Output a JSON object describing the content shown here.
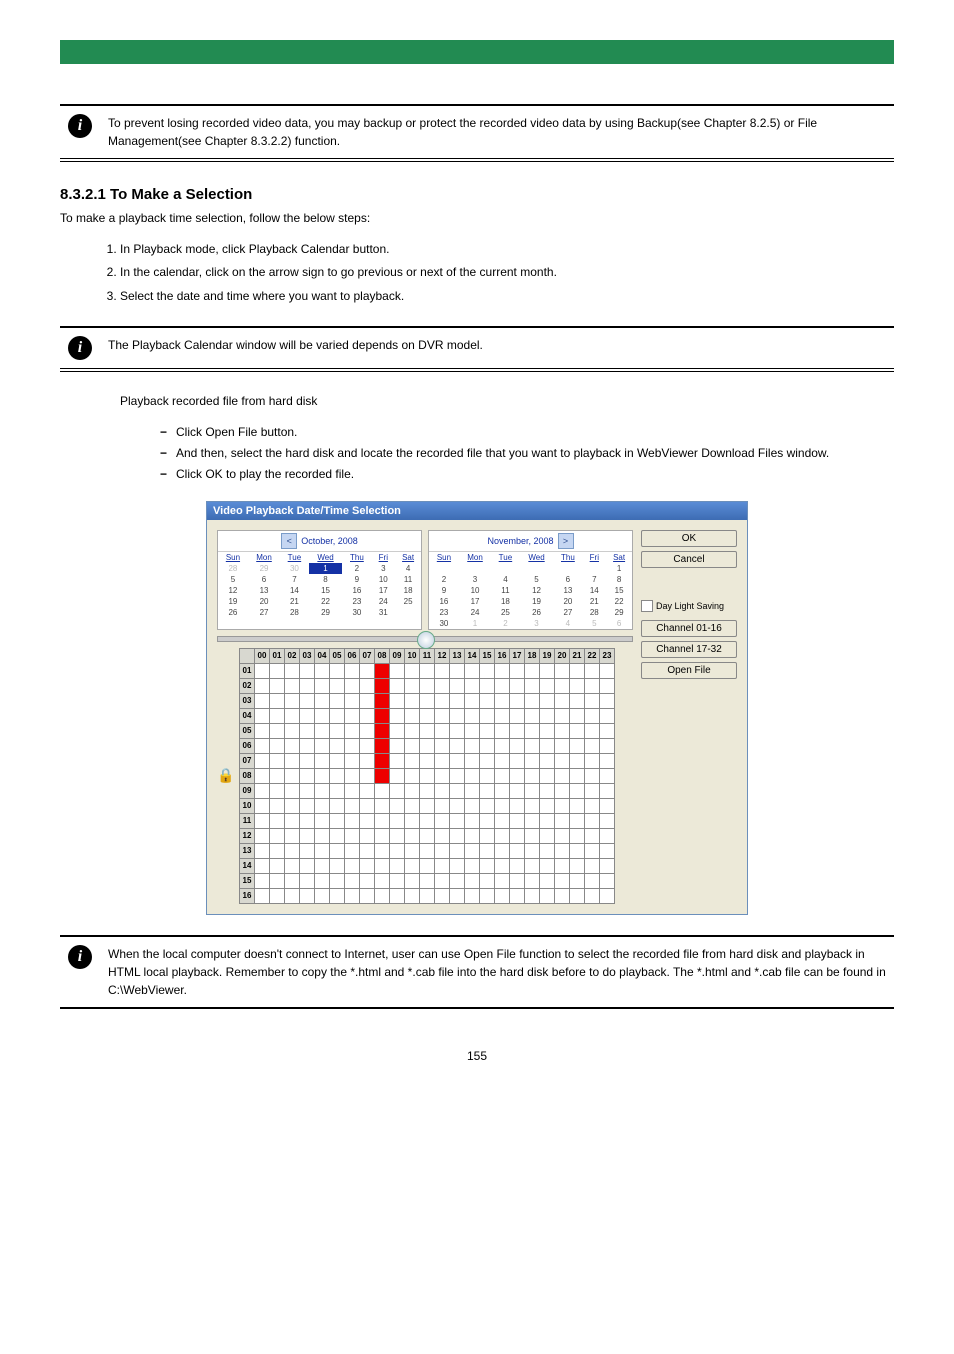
{
  "headerColor": "#228B52",
  "info1": "To prevent losing recorded video data, you may backup or protect the recorded video data by using Backup(see Chapter 8.2.5) or File Management(see Chapter 8.3.2.2) function.",
  "section1": {
    "heading": "8.3.2.1 To Make a Selection",
    "text": "To make a playback time selection, follow the below steps:",
    "steps": [
      "In Playback mode, click Playback Calendar button.",
      "In the calendar, click on the arrow sign to go previous or next of the current month.",
      "Select the date and time where you want to playback."
    ]
  },
  "info2": "The Playback Calendar window will be varied depends on DVR model.",
  "section2": {
    "text1": "Playback recorded file from hard disk",
    "bullets": [
      "Click Open File button.",
      "And then, select the hard disk and locate the recorded file that you want to playback in WebViewer Download Files window.",
      "Click OK to play the recorded file."
    ]
  },
  "dialog": {
    "title": "Video Playback Date/Time Selection",
    "calendar1": {
      "month": "October, 2008",
      "weekdays": [
        "Sun",
        "Mon",
        "Tue",
        "Wed",
        "Thu",
        "Fri",
        "Sat"
      ],
      "rows": [
        [
          "28",
          "29",
          "30",
          "1",
          "2",
          "3",
          "4"
        ],
        [
          "5",
          "6",
          "7",
          "8",
          "9",
          "10",
          "11"
        ],
        [
          "12",
          "13",
          "14",
          "15",
          "16",
          "17",
          "18"
        ],
        [
          "19",
          "20",
          "21",
          "22",
          "23",
          "24",
          "25"
        ],
        [
          "26",
          "27",
          "28",
          "29",
          "30",
          "31",
          ""
        ]
      ],
      "otherCells": [
        "0-0",
        "0-1",
        "0-2"
      ],
      "selected": "0-3"
    },
    "calendar2": {
      "month": "November, 2008",
      "weekdays": [
        "Sun",
        "Mon",
        "Tue",
        "Wed",
        "Thu",
        "Fri",
        "Sat"
      ],
      "rows": [
        [
          "",
          "",
          "",
          "",
          "",
          "",
          "1"
        ],
        [
          "2",
          "3",
          "4",
          "5",
          "6",
          "7",
          "8"
        ],
        [
          "9",
          "10",
          "11",
          "12",
          "13",
          "14",
          "15"
        ],
        [
          "16",
          "17",
          "18",
          "19",
          "20",
          "21",
          "22"
        ],
        [
          "23",
          "24",
          "25",
          "26",
          "27",
          "28",
          "29"
        ],
        [
          "30",
          "1",
          "2",
          "3",
          "4",
          "5",
          "6"
        ]
      ],
      "otherCells": [
        "5-1",
        "5-2",
        "5-3",
        "5-4",
        "5-5",
        "5-6"
      ]
    },
    "buttons": {
      "ok": "OK",
      "cancel": "Cancel",
      "daylight": "Day Light Saving",
      "ch1": "Channel 01-16",
      "ch2": "Channel 17-32",
      "open": "Open File"
    },
    "hours": [
      "00",
      "01",
      "02",
      "03",
      "04",
      "05",
      "06",
      "07",
      "08",
      "09",
      "10",
      "11",
      "12",
      "13",
      "14",
      "15",
      "16",
      "17",
      "18",
      "19",
      "20",
      "21",
      "22",
      "23"
    ],
    "channels": [
      "01",
      "02",
      "03",
      "04",
      "05",
      "06",
      "07",
      "08",
      "09",
      "10",
      "11",
      "12",
      "13",
      "14",
      "15",
      "16"
    ],
    "marked": {
      "01": [
        8
      ],
      "02": [
        8
      ],
      "03": [
        8
      ],
      "04": [
        8
      ],
      "05": [
        8
      ],
      "06": [
        8
      ],
      "07": [
        8
      ],
      "08": [
        8
      ]
    }
  },
  "info3": "When the local computer doesn't connect to Internet, user can use Open File function to select the recorded file from hard disk and playback in HTML local playback. Remember to copy the *.html and *.cab file into the hard disk before to do playback. The *.html and *.cab file can be found in C:\\WebViewer.",
  "pageNumber": "155"
}
